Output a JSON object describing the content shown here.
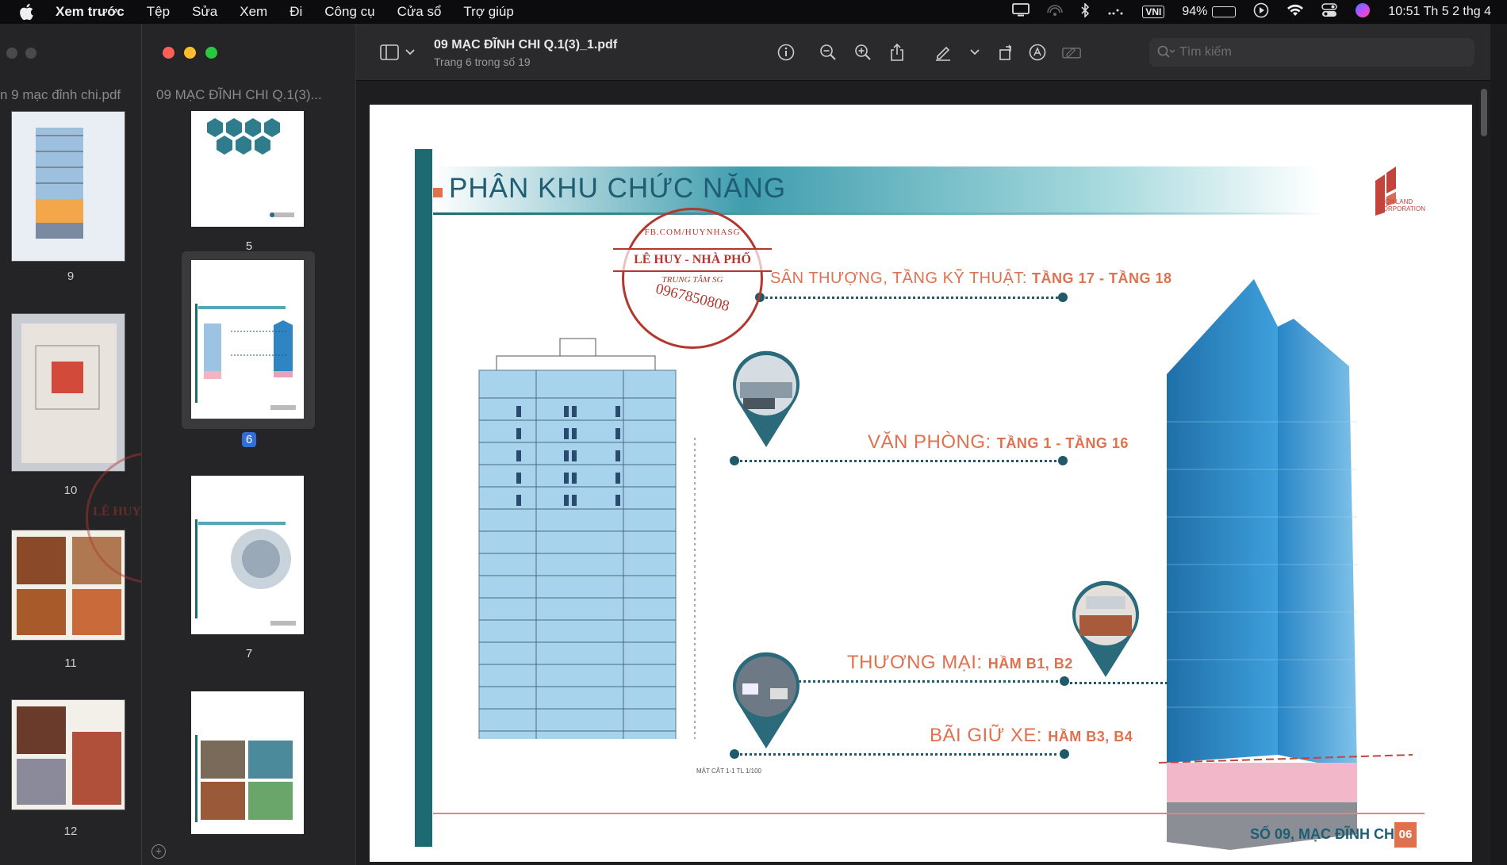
{
  "menubar": {
    "app_name": "Xem trước",
    "items": [
      "Tệp",
      "Sửa",
      "Xem",
      "Đi",
      "Công cụ",
      "Cửa sổ",
      "Trợ giúp"
    ],
    "input_method": "VNI",
    "battery": "94%",
    "battery_fraction": 0.94,
    "clock": "10:51 Th 5 2 thg 4"
  },
  "background_window": {
    "file_name": "n 9 mạc đỉnh chi.pdf",
    "pages": [
      "9",
      "10",
      "11",
      "12"
    ]
  },
  "window": {
    "sidebar_file_name": "09 MẠC ĐĨNH CHI Q.1(3)...",
    "doc_title": "09 MẠC ĐĨNH CHI Q.1(3)_1.pdf",
    "doc_subtitle": "Trang 6 trong số 19",
    "thumbnails": [
      "5",
      "6",
      "7"
    ],
    "selected_page": "6",
    "search_placeholder": "Tìm kiếm"
  },
  "page": {
    "title": "PHÂN KHU CHỨC NĂNG",
    "logo_text": "RICH LAND CORPORATION",
    "zones": [
      {
        "name": "SÂN THƯỢNG, TẦNG KỸ THUẬT:",
        "floors": "TẦNG 17 - TẦNG 18"
      },
      {
        "name": "VĂN PHÒNG:",
        "floors": "TẦNG 1 - TẦNG 16"
      },
      {
        "name": "THƯƠNG MẠI:",
        "floors": "HẦM B1, B2"
      },
      {
        "name": "BÃI GIỮ XE:",
        "floors": "HẦM B3, B4"
      }
    ],
    "section_caption": "MẶT CẮT 1-1  TL 1/100",
    "footer": "SỐ 09, MẠC ĐĨNH CHI",
    "page_number": "06"
  },
  "stamp": {
    "top": "FB.COM/HUYNHASG",
    "name": "LÊ HUY - NHÀ PHỐ",
    "sub": "TRUNG TÂM SG",
    "phone": "0967850808"
  },
  "colors": {
    "accent_teal": "#1e6a72",
    "accent_orange": "#e0714f",
    "stamp_red": "#b2382f",
    "selection_blue": "#2f6fd6"
  }
}
